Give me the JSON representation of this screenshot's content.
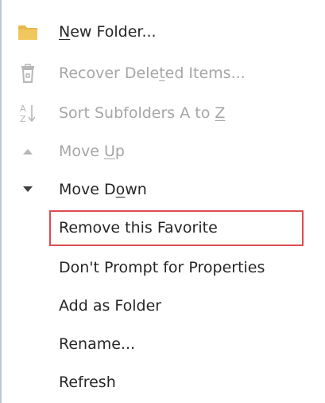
{
  "menu": {
    "items": [
      {
        "pre": "",
        "ul": "N",
        "post": "ew Folder...",
        "disabled": false
      },
      {
        "pre": "Recover Dele",
        "ul": "t",
        "post": "ed Items...",
        "disabled": true
      },
      {
        "pre": "Sort Subfolders A to ",
        "ul": "Z",
        "post": "",
        "disabled": true
      },
      {
        "pre": "Move ",
        "ul": "U",
        "post": "p",
        "disabled": true
      },
      {
        "pre": "Move D",
        "ul": "o",
        "post": "wn",
        "disabled": false
      },
      {
        "pre": "Remove this Favorite",
        "ul": "",
        "post": "",
        "disabled": false
      },
      {
        "pre": "Don't Prompt for Properties",
        "ul": "",
        "post": "",
        "disabled": false
      },
      {
        "pre": "Add as Folder",
        "ul": "",
        "post": "",
        "disabled": false
      },
      {
        "pre": "Rename...",
        "ul": "",
        "post": "",
        "disabled": false
      },
      {
        "pre": "Refresh",
        "ul": "",
        "post": "",
        "disabled": false
      }
    ],
    "icons": [
      "folder-icon",
      "recycle-bin-icon",
      "sort-az-icon",
      "triangle-up-icon",
      "triangle-down-icon"
    ],
    "colors": {
      "text": "#262626",
      "disabled_text": "#a6a6a6",
      "folder": "#e8b84a",
      "highlight_border": "#e04a4f"
    }
  }
}
